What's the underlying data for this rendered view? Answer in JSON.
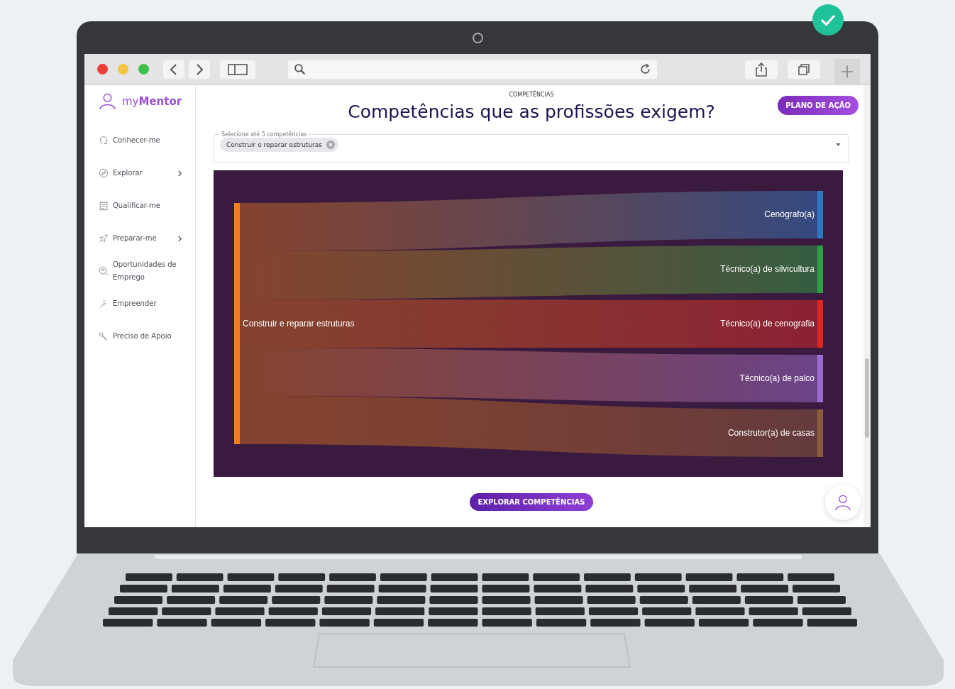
{
  "sidebar": {
    "logo": "my**Mentor**",
    "items": [
      {
        "label": "Conhecer-me",
        "submenu": false
      },
      {
        "label": "Explorar",
        "submenu": true
      },
      {
        "label": "Qualificar-me",
        "submenu": false
      },
      {
        "label": "Preparar-me",
        "submenu": true
      },
      {
        "label": "Oportunidades de Emprego",
        "submenu": false
      },
      {
        "label": "Empreender",
        "submenu": false
      },
      {
        "label": "Preciso de Apoio",
        "submenu": false
      }
    ]
  },
  "header": {
    "eyebrow": "COMPETÊNCIAS",
    "title": "Competências que as profissões exigem?",
    "action_button": "PLANO DE AÇÃO"
  },
  "selector": {
    "label": "Selecione até 5 competências",
    "chips": [
      "Construir e reparar estruturas"
    ]
  },
  "sankey": {
    "source": {
      "label": "Construir e reparar estruturas",
      "color": "#f57f17"
    },
    "targets": [
      {
        "label": "Cenógrafo(a)",
        "color": "#2e78c2"
      },
      {
        "label": "Técnico(a) de silvicultura",
        "color": "#2ea043"
      },
      {
        "label": "Técnico(a) de cenografia",
        "color": "#dc2626"
      },
      {
        "label": "Técnico(a) de palco",
        "color": "#9b6bd1"
      },
      {
        "label": "Construtor(a) de casas",
        "color": "#8d5a3b"
      }
    ]
  },
  "footer_button": "EXPLORAR COMPETÊNCIAS"
}
